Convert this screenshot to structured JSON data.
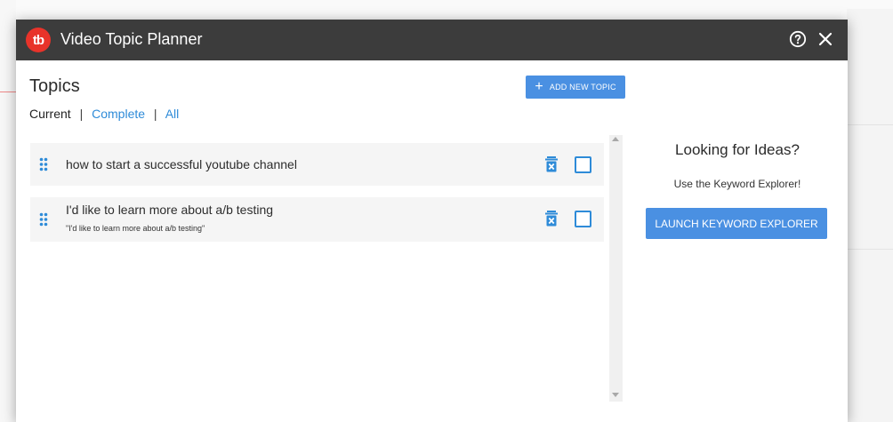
{
  "app": {
    "title": "Video Topic Planner",
    "logo_text": "tb",
    "brand_color": "#e8332a",
    "accent_color": "#4a90e2"
  },
  "icons": {
    "help": "help-circle-icon",
    "close": "close-icon",
    "drag": "drag-handle-icon",
    "trash": "trash-icon",
    "plus": "plus-icon"
  },
  "topics": {
    "heading": "Topics",
    "add_button": "ADD NEW TOPIC",
    "filters": {
      "current": "Current",
      "complete": "Complete",
      "all": "All",
      "separator": "|"
    },
    "items": [
      {
        "title": "how to start a successful youtube channel",
        "subtitle": "",
        "checked": false
      },
      {
        "title": "I'd like to learn more about a/b testing",
        "subtitle": "\"I'd like to learn more about a/b testing\"",
        "checked": false
      }
    ]
  },
  "ideas": {
    "title": "Looking for Ideas?",
    "subtitle": "Use the Keyword Explorer!",
    "button": "LAUNCH KEYWORD EXPLORER"
  }
}
